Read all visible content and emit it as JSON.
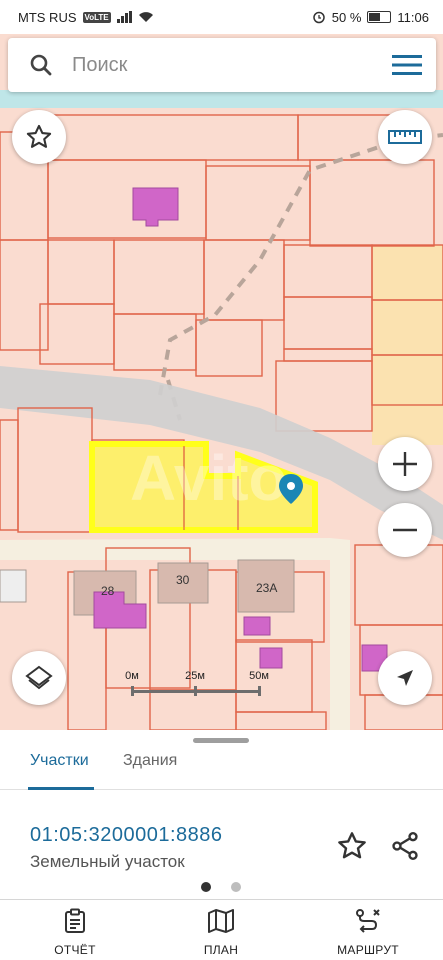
{
  "status_bar": {
    "carrier": "MTS RUS",
    "volte": "VoLTE",
    "battery": "50 %",
    "time": "11:06"
  },
  "search": {
    "placeholder": "Поиск"
  },
  "map": {
    "plot_labels": [
      "28",
      "30",
      "23А"
    ],
    "scale": {
      "labels": [
        "0м",
        "25м",
        "50м"
      ]
    },
    "watermark": "Avito"
  },
  "tabs": [
    {
      "label": "Участки",
      "active": true
    },
    {
      "label": "Здания",
      "active": false
    }
  ],
  "parcel": {
    "number": "01:05:3200001:8886",
    "type": "Земельный участок"
  },
  "pager": {
    "total": 2,
    "active": 1
  },
  "bottom_nav": [
    {
      "label": "ОТЧЁТ",
      "icon": "report-icon"
    },
    {
      "label": "ПЛАН",
      "icon": "map-plan-icon"
    },
    {
      "label": "МАРШРУТ",
      "icon": "route-icon"
    }
  ],
  "colors": {
    "accent": "#1c6b9a",
    "parcel_fill": "#fadcd0",
    "parcel_border": "#e0654a",
    "selected_parcel": "#ffff1a",
    "building": "#d066c8",
    "road": "#cfcfcf"
  }
}
